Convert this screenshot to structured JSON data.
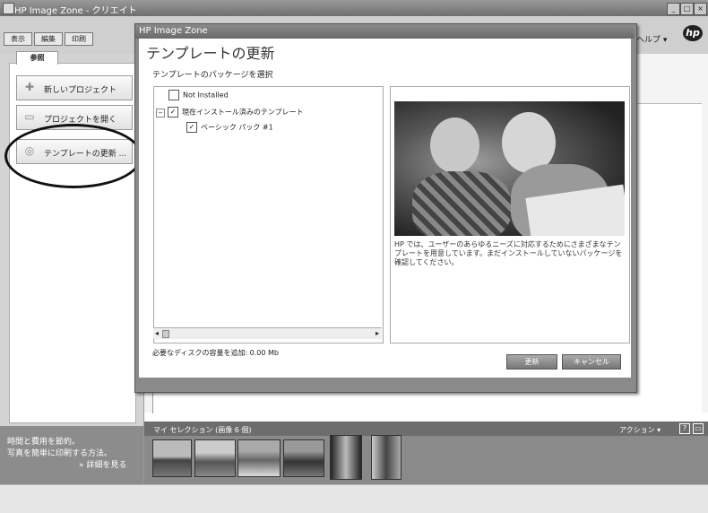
{
  "main_window": {
    "title": "HP Image Zone - クリエイト",
    "tabs": [
      "表示",
      "編集",
      "印刷"
    ],
    "help_menu": "ヘルプ ▾",
    "logo": "hp"
  },
  "left_panel": {
    "tab_label": "参照",
    "tasks": [
      {
        "label": "新しいプロジェクト",
        "icon": "plus-icon"
      },
      {
        "label": "プロジェクトを開く",
        "icon": "folder-icon"
      },
      {
        "label": "テンプレートの更新 ...",
        "icon": "cd-icon"
      }
    ],
    "promo": {
      "line1": "時間と費用を節約。",
      "line2": "写真を簡単に印刷する方法。",
      "link": "» 詳細を見る"
    }
  },
  "selection_strip": {
    "title": "マイ セレクション (画像 6 個)",
    "actions": "アクション ▾",
    "thumbnail_count": 6
  },
  "dialog": {
    "title": "HP Image Zone",
    "heading": "テンプレートの更新",
    "subheading": "テンプレートのパッケージを選択",
    "tree": {
      "not_installed": "Not Installed",
      "installed": "現在インストール済みのテンプレート",
      "basic_pack": "ベーシック パック #1",
      "installed_checked": true,
      "basic_pack_checked": true
    },
    "description": "HP では、ユーザーのあらゆるニーズに対応するためにさまざまなテンプレートを用意しています。まだインストールしていないパッケージを確認してください。",
    "disk_space": "必要なディスクの容量を追加: 0.00 Mb",
    "buttons": {
      "update": "更新",
      "cancel": "キャンセル"
    }
  },
  "colors": {
    "dialog_title_bar": "#7a7a7a",
    "left_panel": "#d3d3d3",
    "selection_strip": "#8a8a8a"
  }
}
